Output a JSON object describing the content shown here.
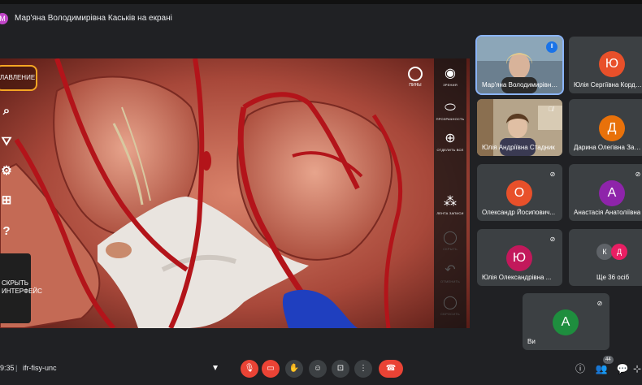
{
  "top": {
    "presenter_initial": "M",
    "presenter_text": "Мар'яна Володимирівна Каськів на екрані"
  },
  "share": {
    "contents_label": "ГЛАВЛЕНИЕ",
    "left_tools": [
      "search-icon",
      "filter-icon",
      "gear-icon",
      "add-icon",
      "help-icon"
    ],
    "hide_ui_label": "СКРЫТЬ ИНТЕРФЕЙС",
    "pin_label": "ПИНЫ",
    "right_tools": [
      {
        "icon": "eye-icon",
        "label": "ЗРЕНИЯ"
      },
      {
        "icon": "transparency-icon",
        "label": "ПРОЗРАЧНОСТЬ"
      },
      {
        "icon": "isolate-icon",
        "label": "ОТДЕЛИТЬ ВСЕ"
      },
      {
        "icon": "dissect-icon",
        "label": "ЛЕНТА ЗАПИСИ"
      },
      {
        "icon": "hide-icon",
        "label": "СКРЫТЬ"
      },
      {
        "icon": "undo-icon",
        "label": "ОТМЕНИТЬ"
      },
      {
        "icon": "reset-icon",
        "label": "СБРОСИТЬ"
      }
    ]
  },
  "participants": [
    {
      "name": "Мар'яна Володимирівна ...",
      "type": "video",
      "speaking": true
    },
    {
      "name": "Юлія Сергіївна Кордиш",
      "initial": "Ю",
      "color": "#e8502a"
    },
    {
      "name": "Юлія Андріївна Стадник",
      "type": "video",
      "muted": true
    },
    {
      "name": "Дарина Олегівна Заславець",
      "initial": "Д",
      "color": "#e8710a"
    },
    {
      "name": "Олександр Йосипович...",
      "initial": "О",
      "color": "#e8502a",
      "muted": true
    },
    {
      "name": "Анастасія Анатоліївна",
      "initial": "А",
      "color": "#8e24aa",
      "muted": true
    },
    {
      "name": "Юлія Олександрівна ...",
      "initial": "Ю",
      "color": "#c2185b",
      "muted": true
    },
    {
      "name": "Ще 36 осіб",
      "initials": [
        "К",
        "Д"
      ]
    },
    {
      "name": "Ви",
      "initial": "А",
      "color": "#1e8e3e",
      "muted": true
    }
  ],
  "bottom": {
    "time": "9:35",
    "separator": "|",
    "meeting_code": "ifr-fisy-unc",
    "participant_count": "44",
    "controls": [
      "mic-off-icon",
      "camera-off-icon",
      "raise-hand-icon",
      "emoji-icon",
      "present-icon",
      "more-icon",
      "hang-up-icon"
    ],
    "right_controls": [
      "info-icon",
      "people-icon",
      "chat-icon",
      "activities-icon"
    ]
  }
}
